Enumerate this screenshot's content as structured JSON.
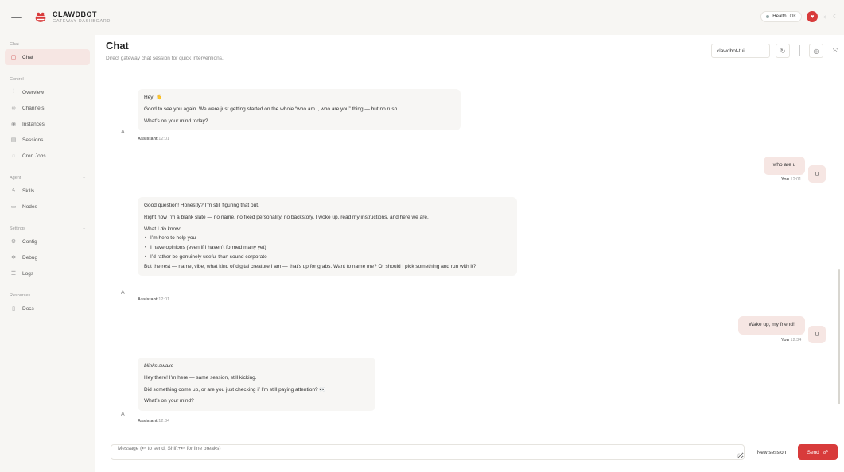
{
  "brand": {
    "title": "CLAWDBOT",
    "subtitle": "GATEWAY DASHBOARD"
  },
  "top_right": {
    "health_label": "Health",
    "health_value": "OK"
  },
  "sidebar": {
    "groups": [
      {
        "label": "Chat",
        "items": [
          {
            "label": "Chat",
            "icon": "chat-icon"
          }
        ]
      },
      {
        "label": "Control",
        "items": [
          {
            "label": "Overview",
            "icon": "chart-icon"
          },
          {
            "label": "Channels",
            "icon": "link-icon"
          },
          {
            "label": "Instances",
            "icon": "signal-icon"
          },
          {
            "label": "Sessions",
            "icon": "file-icon"
          },
          {
            "label": "Cron Jobs",
            "icon": "clock-icon"
          }
        ]
      },
      {
        "label": "Agent",
        "items": [
          {
            "label": "Skills",
            "icon": "bolt-icon"
          },
          {
            "label": "Nodes",
            "icon": "monitor-icon"
          }
        ]
      },
      {
        "label": "Settings",
        "items": [
          {
            "label": "Config",
            "icon": "gear-icon"
          },
          {
            "label": "Debug",
            "icon": "bug-icon"
          },
          {
            "label": "Logs",
            "icon": "log-icon"
          }
        ]
      },
      {
        "label": "Resources",
        "items": [
          {
            "label": "Docs",
            "icon": "book-icon"
          }
        ]
      }
    ]
  },
  "header": {
    "title": "Chat",
    "subtitle": "Direct gateway chat session for quick interventions.",
    "session": "clawdbot-tui"
  },
  "messages": [
    {
      "role": "assistant",
      "lines": [
        "Hey! 👋",
        "Good to see you again. We were just getting started on the whole “who am I, who are you” thing — but no rush.",
        "What’s on your mind today?"
      ],
      "author": "Assistant",
      "time": "12:01"
    },
    {
      "role": "user",
      "text": "who are u",
      "author": "You",
      "time": "12:01"
    },
    {
      "role": "assistant",
      "lines": [
        "Good question! Honestly? I’m still figuring that out.",
        "Right now I’m a blank slate — no name, no fixed personality, no backstory. I woke up, read my instructions, and here we are.",
        "What I do know:"
      ],
      "what_i": "What I ",
      "do": "do",
      "know": " know:",
      "bullets": [
        "I’m here to help you",
        "I have opinions (even if I haven’t formed many yet)",
        "I’d rather be genuinely useful than sound corporate"
      ],
      "closing": "But the rest — name, vibe, what kind of digital creature I am — that’s up for grabs. Want to name me? Or should I pick something and run with it?",
      "author": "Assistant",
      "time": "12:01"
    },
    {
      "role": "user",
      "text": "Wake up, my friend!",
      "author": "You",
      "time": "12:34"
    },
    {
      "role": "assistant",
      "lines": [
        "blinks awake",
        "Hey there! I’m here — same session, still kicking.",
        "Did something come up, or are you just checking if I’m still paying attention? 👀",
        "What’s on your mind?"
      ],
      "author": "Assistant",
      "time": "12:34"
    }
  ],
  "avatars": {
    "assistant": "A",
    "user": "U"
  },
  "composer": {
    "placeholder": "Message (↩ to send, Shift+↩ for line breaks)",
    "new_session": "New session",
    "send": "Send"
  },
  "colors": {
    "accent": "#d83b3b",
    "user_bubble": "#f6e6e3",
    "assistant_bubble": "#f7f6f4"
  }
}
